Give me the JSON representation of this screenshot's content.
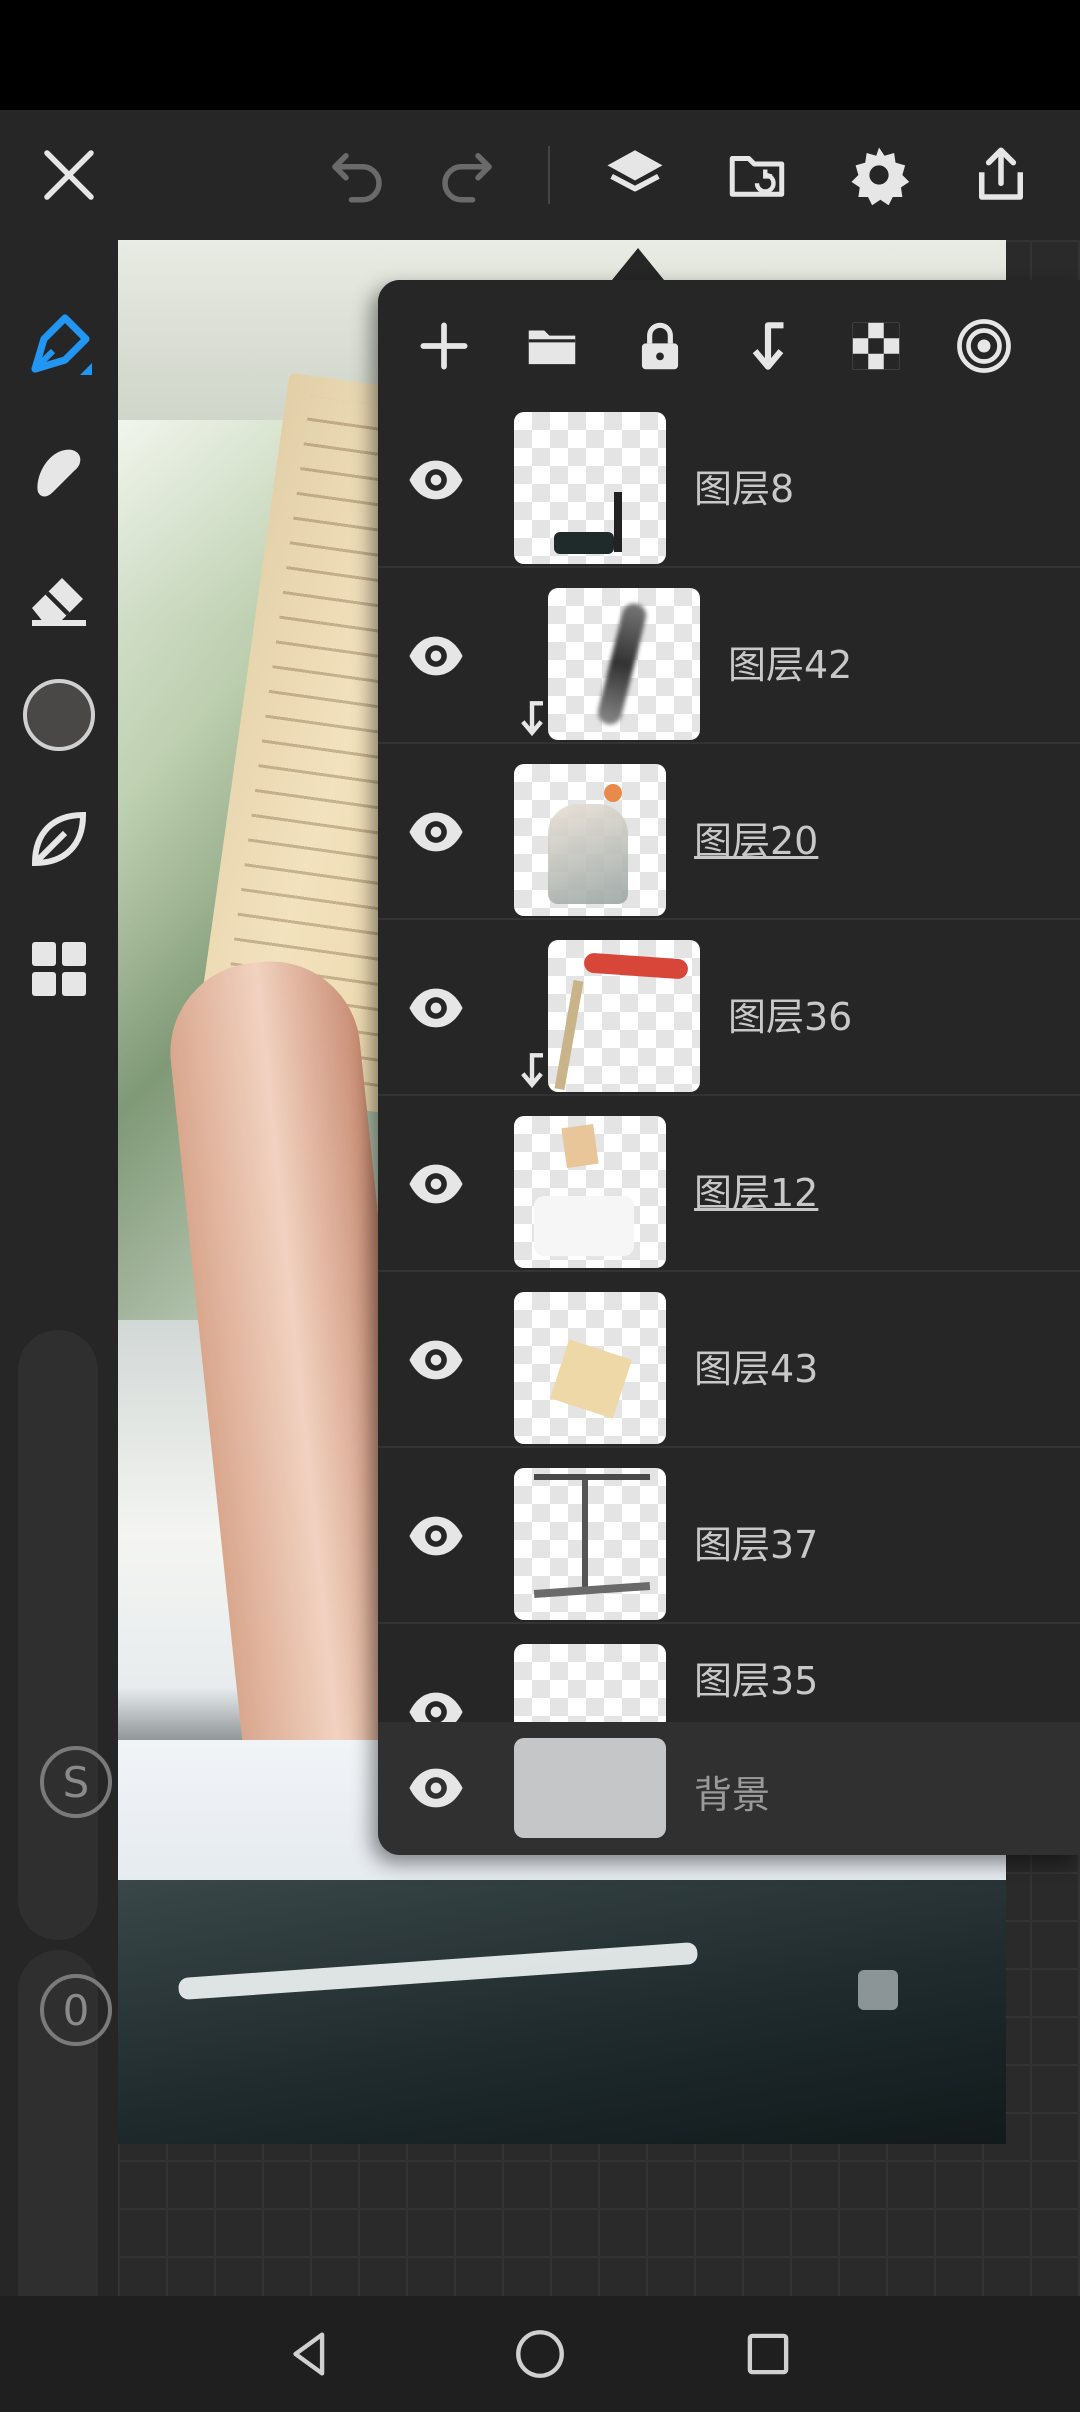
{
  "layers_panel": {
    "layers": [
      {
        "name": "图层8",
        "visible": true,
        "clipped": false,
        "underlined": false
      },
      {
        "name": "图层42",
        "visible": true,
        "clipped": true,
        "underlined": false
      },
      {
        "name": "图层20",
        "visible": true,
        "clipped": false,
        "underlined": true
      },
      {
        "name": "图层36",
        "visible": true,
        "clipped": true,
        "underlined": false
      },
      {
        "name": "图层12",
        "visible": true,
        "clipped": false,
        "underlined": true
      },
      {
        "name": "图层43",
        "visible": true,
        "clipped": false,
        "underlined": false
      },
      {
        "name": "图层37",
        "visible": true,
        "clipped": false,
        "underlined": false
      },
      {
        "name": "图层35",
        "visible": true,
        "clipped": false,
        "underlined": false
      }
    ],
    "background": {
      "name": "背景",
      "visible": true
    }
  },
  "tool_rail": {
    "current_color": "#4a4846",
    "selected_tool_color": "#2196f3",
    "size_badge": "S",
    "opacity_badge": "0"
  },
  "colors": {
    "accent": "#2196f3",
    "icon": "#e6e6e6",
    "icon_disabled": "#6a6a6a"
  }
}
